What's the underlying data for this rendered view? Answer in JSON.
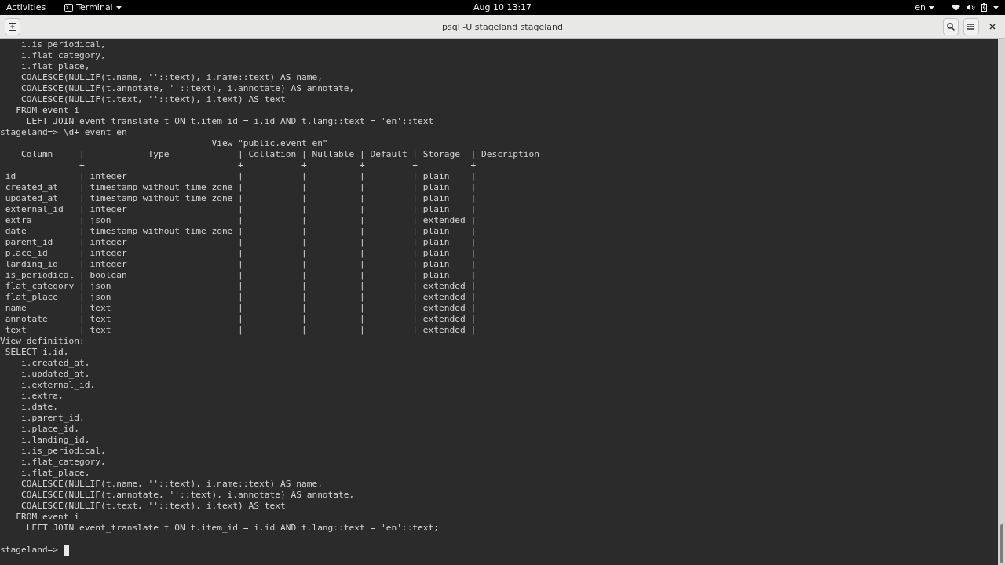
{
  "top_bar": {
    "activities": "Activities",
    "app_menu": "Terminal",
    "clock": "Aug 10  13:17",
    "language": "en"
  },
  "window": {
    "title": "psql -U stageland stageland"
  },
  "terminal": {
    "lines": [
      "    i.is_periodical,",
      "    i.flat_category,",
      "    i.flat_place,",
      "    COALESCE(NULLIF(t.name, ''::text), i.name::text) AS name,",
      "    COALESCE(NULLIF(t.annotate, ''::text), i.annotate) AS annotate,",
      "    COALESCE(NULLIF(t.text, ''::text), i.text) AS text",
      "   FROM event i",
      "     LEFT JOIN event_translate t ON t.item_id = i.id AND t.lang::text = 'en'::text",
      "stageland=> \\d+ event_en",
      "                                        View \"public.event_en\"",
      "    Column     |            Type             | Collation | Nullable | Default | Storage  | Description",
      "---------------+-----------------------------+-----------+----------+---------+----------+-------------",
      " id            | integer                     |           |          |         | plain    |",
      " created_at    | timestamp without time zone |           |          |         | plain    |",
      " updated_at    | timestamp without time zone |           |          |         | plain    |",
      " external_id   | integer                     |           |          |         | plain    |",
      " extra         | json                        |           |          |         | extended |",
      " date          | timestamp without time zone |           |          |         | plain    |",
      " parent_id     | integer                     |           |          |         | plain    |",
      " place_id      | integer                     |           |          |         | plain    |",
      " landing_id    | integer                     |           |          |         | plain    |",
      " is_periodical | boolean                     |           |          |         | plain    |",
      " flat_category | json                        |           |          |         | extended |",
      " flat_place    | json                        |           |          |         | extended |",
      " name          | text                        |           |          |         | extended |",
      " annotate      | text                        |           |          |         | extended |",
      " text          | text                        |           |          |         | extended |",
      "View definition:",
      " SELECT i.id,",
      "    i.created_at,",
      "    i.updated_at,",
      "    i.external_id,",
      "    i.extra,",
      "    i.date,",
      "    i.parent_id,",
      "    i.place_id,",
      "    i.landing_id,",
      "    i.is_periodical,",
      "    i.flat_category,",
      "    i.flat_place,",
      "    COALESCE(NULLIF(t.name, ''::text), i.name::text) AS name,",
      "    COALESCE(NULLIF(t.annotate, ''::text), i.annotate) AS annotate,",
      "    COALESCE(NULLIF(t.text, ''::text), i.text) AS text",
      "   FROM event i",
      "     LEFT JOIN event_translate t ON t.item_id = i.id AND t.lang::text = 'en'::text;"
    ],
    "prompt": "stageland=>"
  }
}
